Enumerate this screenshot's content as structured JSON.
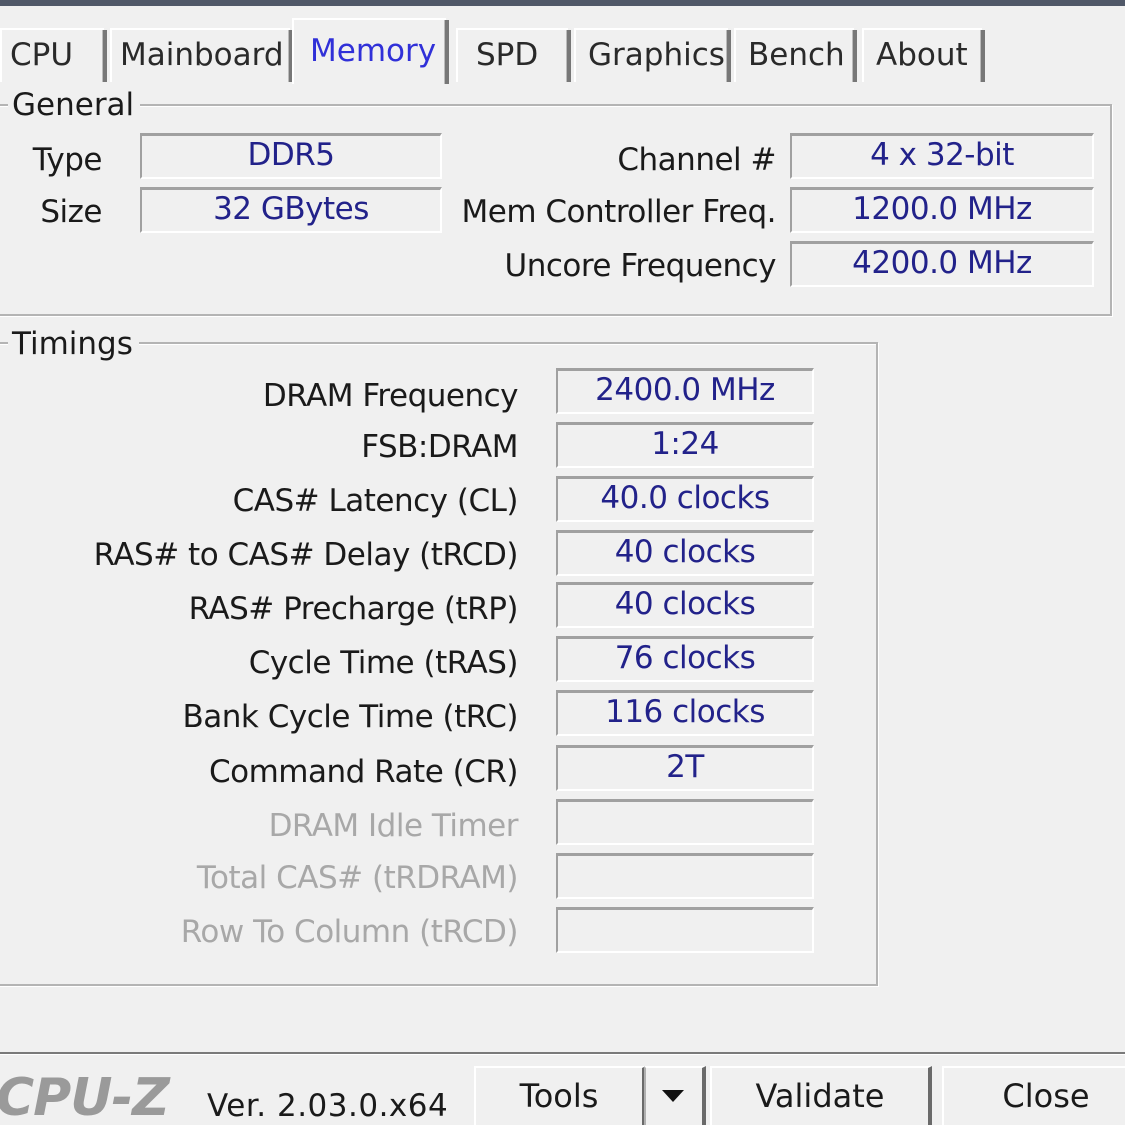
{
  "tabs": [
    {
      "label": "CPU",
      "active": false
    },
    {
      "label": "Mainboard",
      "active": false
    },
    {
      "label": "Memory",
      "active": true
    },
    {
      "label": "SPD",
      "active": false
    },
    {
      "label": "Graphics",
      "active": false
    },
    {
      "label": "Bench",
      "active": false
    },
    {
      "label": "About",
      "active": false
    }
  ],
  "general": {
    "title": "General",
    "type_label": "Type",
    "type_value": "DDR5",
    "size_label": "Size",
    "size_value": "32 GBytes",
    "channel_label": "Channel #",
    "channel_value": "4 x 32-bit",
    "mem_ctrl_label": "Mem Controller Freq.",
    "mem_ctrl_value": "1200.0 MHz",
    "uncore_label": "Uncore Frequency",
    "uncore_value": "4200.0 MHz"
  },
  "timings": {
    "title": "Timings",
    "rows": [
      {
        "label": "DRAM Frequency",
        "value": "2400.0 MHz",
        "disabled": false
      },
      {
        "label": "FSB:DRAM",
        "value": "1:24",
        "disabled": false
      },
      {
        "label": "CAS# Latency (CL)",
        "value": "40.0 clocks",
        "disabled": false
      },
      {
        "label": "RAS# to CAS# Delay (tRCD)",
        "value": "40 clocks",
        "disabled": false
      },
      {
        "label": "RAS# Precharge (tRP)",
        "value": "40 clocks",
        "disabled": false
      },
      {
        "label": "Cycle Time (tRAS)",
        "value": "76 clocks",
        "disabled": false
      },
      {
        "label": "Bank Cycle Time (tRC)",
        "value": "116 clocks",
        "disabled": false
      },
      {
        "label": "Command Rate (CR)",
        "value": "2T",
        "disabled": false
      },
      {
        "label": "DRAM Idle Timer",
        "value": "",
        "disabled": true
      },
      {
        "label": "Total CAS# (tRDRAM)",
        "value": "",
        "disabled": true
      },
      {
        "label": "Row To Column (tRCD)",
        "value": "",
        "disabled": true
      }
    ]
  },
  "footer": {
    "logo": "CPU-Z",
    "version": "Ver. 2.03.0.x64",
    "tools_label": "Tools",
    "tools_dropdown_icon": "triangle-down",
    "validate_label": "Validate",
    "close_label": "Close"
  }
}
